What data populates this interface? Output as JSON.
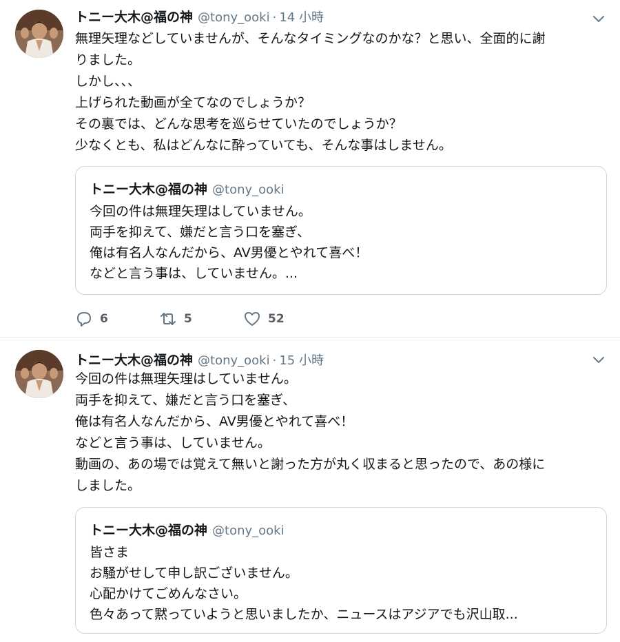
{
  "tweets": [
    {
      "author": {
        "name": "トニー大木@福の神",
        "handle": "@tony_ooki"
      },
      "separator": "·",
      "time": "14 小時",
      "lines": [
        "無理矢理などしていませんが、そんなタイミングなのかな？と思い、全面的に謝",
        "りました。",
        "しかし、、、",
        "上げられた動画が全てなのでしょうか？",
        "その裏では、どんな思考を巡らせていたのでしょうか？",
        "少なくとも、私はどんなに酔っていても、そんな事はしません。"
      ],
      "quote": {
        "name": "トニー大木@福の神",
        "handle": "@tony_ooki",
        "lines": [
          "今回の件は無理矢理はしていません。",
          "両手を抑えて、嫌だと言う口を塞ぎ、",
          "俺は有名人なんだから、AV男優とやれて喜べ！",
          "などと言う事は、していません。..."
        ]
      },
      "actions": {
        "reply_count": "6",
        "retweet_count": "5",
        "like_count": "52",
        "reply_icon": "reply-icon",
        "retweet_icon": "retweet-icon",
        "like_icon": "heart-icon"
      }
    },
    {
      "author": {
        "name": "トニー大木@福の神",
        "handle": "@tony_ooki"
      },
      "separator": "·",
      "time": "15 小時",
      "lines": [
        "今回の件は無理矢理はしていません。",
        "両手を抑えて、嫌だと言う口を塞ぎ、",
        "俺は有名人なんだから、AV男優とやれて喜べ！",
        "などと言う事は、していません。",
        "動画の、あの場では覚えて無いと謝った方が丸く収まると思ったので、あの様に",
        "しました。"
      ],
      "quote": {
        "name": "トニー大木@福の神",
        "handle": "@tony_ooki",
        "lines": [
          "皆さま",
          "お騒がせして申し訳ございません。",
          "心配かけてごめんなさい。",
          "色々あって黙っていようと思いましたか、ニュースはアジアでも沢山取..."
        ]
      }
    }
  ],
  "colors": {
    "text": "#14171a",
    "secondary": "#657786",
    "border": "#ccd6dd",
    "divider": "#e6ecf0"
  }
}
